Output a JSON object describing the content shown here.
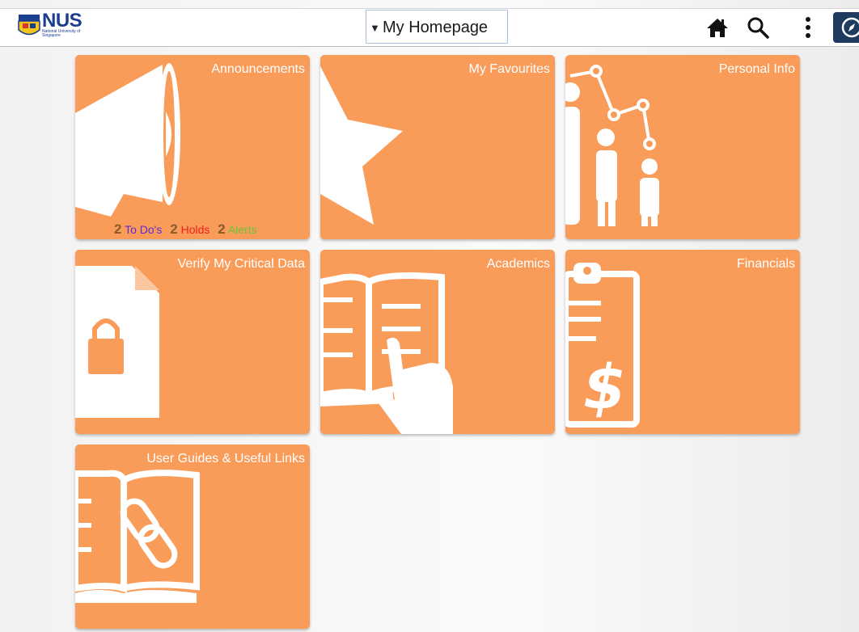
{
  "header": {
    "logo_text": "NUS",
    "logo_subtitle": "National University of Singapore",
    "homepage_label": "My Homepage"
  },
  "tiles": [
    {
      "title": "Announcements"
    },
    {
      "title": "My Favourites"
    },
    {
      "title": "Personal Info"
    },
    {
      "title": "Verify My Critical Data"
    },
    {
      "title": "Academics"
    },
    {
      "title": "Financials"
    },
    {
      "title": "User Guides & Useful Links"
    }
  ],
  "announcements": {
    "todo_count": "2",
    "todo_label": "To Do's",
    "holds_count": "2",
    "holds_label": "Holds",
    "alerts_count": "2",
    "alerts_label": "Alerts"
  },
  "colors": {
    "tile": "#f99c5a",
    "brand": "#1b3f8f",
    "todo": "#5a2bd4",
    "holds": "#ef1f1f",
    "alerts": "#66c43c"
  },
  "icons": [
    "home-icon",
    "search-icon",
    "more-icon",
    "navigator-icon"
  ]
}
